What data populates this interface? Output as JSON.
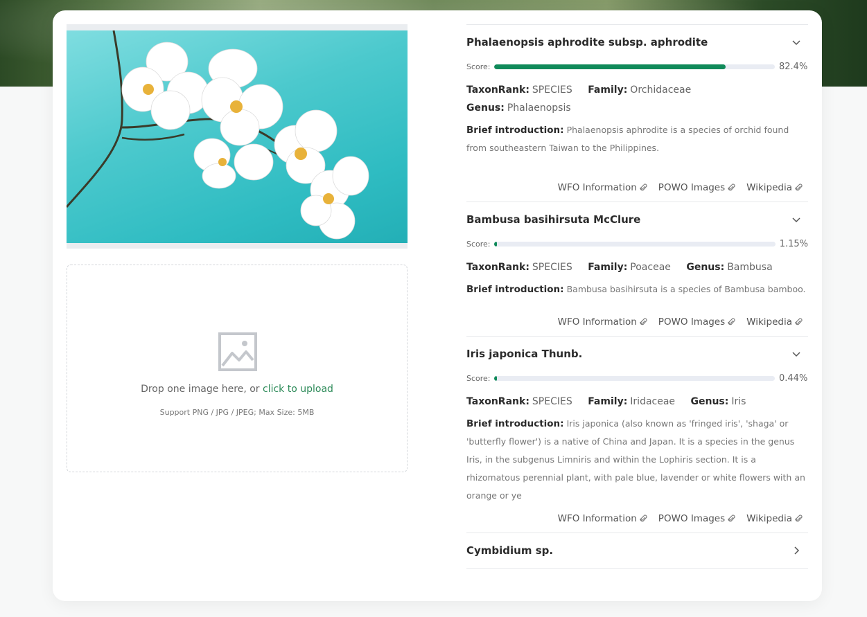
{
  "upload": {
    "drop_text": "Drop one image here, or ",
    "drop_link": "click to upload",
    "support_text": "Support PNG / JPG / JPEG; Max Size: 5MB"
  },
  "labels": {
    "score": "Score:",
    "taxon_rank": "TaxonRank:",
    "family": "Family:",
    "genus": "Genus:",
    "brief": "Brief introduction:",
    "wfo": "WFO Information",
    "powo": "POWO Images",
    "wiki": "Wikipedia"
  },
  "results": [
    {
      "name": "Phalaenopsis aphrodite subsp. aphrodite",
      "score": 0.824,
      "score_text": "82.4%",
      "taxon_rank": "SPECIES",
      "family": "Orchidaceae",
      "genus": "Phalaenopsis",
      "intro": "Phalaenopsis aphrodite is a species of orchid found from southeastern Taiwan to the Philippines."
    },
    {
      "name": "Bambusa basihirsuta McClure",
      "score": 0.0115,
      "score_text": "1.15%",
      "taxon_rank": "SPECIES",
      "family": "Poaceae",
      "genus": "Bambusa",
      "intro": "Bambusa basihirsuta is a species of Bambusa bamboo."
    },
    {
      "name": "Iris japonica Thunb.",
      "score": 0.0044,
      "score_text": "0.44%",
      "taxon_rank": "SPECIES",
      "family": "Iridaceae",
      "genus": "Iris",
      "intro": "Iris japonica (also known as 'fringed iris', 'shaga' or 'butterfly flower') is a native of China and Japan. It is a species in the genus Iris, in the subgenus Limniris and within the Lophiris section. It is a rhizomatous perennial plant, with pale blue, lavender or white flowers with an orange or ye"
    },
    {
      "name": "Cymbidium sp."
    }
  ],
  "colors": {
    "accent": "#108a5a",
    "link_green": "#2c8a58",
    "bar_track": "#e9ecf3"
  }
}
